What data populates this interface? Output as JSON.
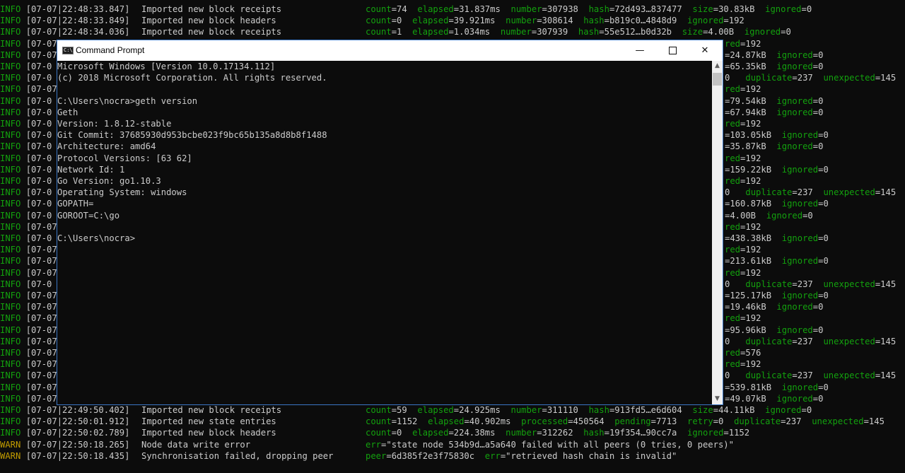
{
  "background_log": [
    {
      "level": "INFO",
      "time": "[07-07|22:48:33.847]",
      "msg": "Imported new block receipts",
      "fields": [
        [
          "count",
          "74"
        ],
        [
          "elapsed",
          "31.837ms"
        ],
        [
          "number",
          "307938"
        ],
        [
          "hash",
          "72d493…837477"
        ],
        [
          "size",
          "30.83kB"
        ],
        [
          "ignored",
          "0"
        ]
      ],
      "right": []
    },
    {
      "level": "INFO",
      "time": "[07-07|22:48:33.849]",
      "msg": "Imported new block headers",
      "fields": [
        [
          "count",
          "0"
        ],
        [
          "elapsed",
          "39.921ms"
        ],
        [
          "number",
          "308614"
        ],
        [
          "hash",
          "b819c0…4848d9"
        ],
        [
          "ignored",
          "192"
        ]
      ],
      "right": []
    },
    {
      "level": "INFO",
      "time": "[07-07|22:48:34.036]",
      "msg": "Imported new block receipts",
      "fields": [
        [
          "count",
          "1"
        ],
        [
          "elapsed",
          "1.034ms"
        ],
        [
          "number",
          "307939"
        ],
        [
          "hash",
          "55e512…b0d32b"
        ],
        [
          "size",
          "4.00B"
        ],
        [
          "ignored",
          "0"
        ]
      ],
      "right": []
    },
    {
      "level": "INFO",
      "time": "[07-07",
      "msg": "",
      "fields": [],
      "right": [
        [
          "red",
          "192"
        ]
      ]
    },
    {
      "level": "INFO",
      "time": "[07-07",
      "msg": "",
      "fields": [],
      "right": [
        [
          "",
          "24.87kB"
        ],
        [
          "ignored",
          "0"
        ]
      ]
    },
    {
      "level": "INFO",
      "time": "[07-0",
      "msg": "",
      "fields": [],
      "right": [
        [
          "",
          "65.35kB"
        ],
        [
          "ignored",
          "0"
        ]
      ]
    },
    {
      "level": "INFO",
      "time": "[07-0",
      "msg": "",
      "fields": [],
      "right": [
        [
          "0 ",
          ""
        ],
        [
          "duplicate",
          "237"
        ],
        [
          "unexpected",
          "145"
        ]
      ]
    },
    {
      "level": "INFO",
      "time": "[07-07",
      "msg": "",
      "fields": [],
      "right": [
        [
          "red",
          "192"
        ]
      ]
    },
    {
      "level": "INFO",
      "time": "[07-0",
      "msg": "",
      "fields": [],
      "right": [
        [
          "",
          "79.54kB"
        ],
        [
          "ignored",
          "0"
        ]
      ]
    },
    {
      "level": "INFO",
      "time": "[07-0",
      "msg": "",
      "fields": [],
      "right": [
        [
          "",
          "67.94kB"
        ],
        [
          "ignored",
          "0"
        ]
      ]
    },
    {
      "level": "INFO",
      "time": "[07-0",
      "msg": "",
      "fields": [],
      "right": [
        [
          "red",
          "192"
        ]
      ]
    },
    {
      "level": "INFO",
      "time": "[07-0",
      "msg": "",
      "fields": [],
      "right": [
        [
          "",
          "103.05kB"
        ],
        [
          "ignored",
          "0"
        ]
      ]
    },
    {
      "level": "INFO",
      "time": "[07-0",
      "msg": "",
      "fields": [],
      "right": [
        [
          "",
          "35.87kB"
        ],
        [
          "ignored",
          "0"
        ]
      ]
    },
    {
      "level": "INFO",
      "time": "[07-0",
      "msg": "",
      "fields": [],
      "right": [
        [
          "red",
          "192"
        ]
      ]
    },
    {
      "level": "INFO",
      "time": "[07-0",
      "msg": "",
      "fields": [],
      "right": [
        [
          "",
          "159.22kB"
        ],
        [
          "ignored",
          "0"
        ]
      ]
    },
    {
      "level": "INFO",
      "time": "[07-0",
      "msg": "",
      "fields": [],
      "right": [
        [
          "red",
          "192"
        ]
      ]
    },
    {
      "level": "INFO",
      "time": "[07-0",
      "msg": "",
      "fields": [],
      "right": [
        [
          "0 ",
          ""
        ],
        [
          "duplicate",
          "237"
        ],
        [
          "unexpected",
          "145"
        ]
      ]
    },
    {
      "level": "INFO",
      "time": "[07-0",
      "msg": "",
      "fields": [],
      "right": [
        [
          "",
          "160.87kB"
        ],
        [
          "ignored",
          "0"
        ]
      ]
    },
    {
      "level": "INFO",
      "time": "[07-0",
      "msg": "",
      "fields": [],
      "right": [
        [
          "",
          "4.00B"
        ],
        [
          "ignored",
          "0"
        ]
      ]
    },
    {
      "level": "INFO",
      "time": "[07-07",
      "msg": "",
      "fields": [],
      "right": [
        [
          "red",
          "192"
        ]
      ]
    },
    {
      "level": "INFO",
      "time": "[07-0",
      "msg": "",
      "fields": [],
      "right": [
        [
          "",
          "438.38kB"
        ],
        [
          "ignored",
          "0"
        ]
      ]
    },
    {
      "level": "INFO",
      "time": "[07-07",
      "msg": "",
      "fields": [],
      "right": [
        [
          "red",
          "192"
        ]
      ]
    },
    {
      "level": "INFO",
      "time": "[07-07",
      "msg": "",
      "fields": [],
      "right": [
        [
          "",
          "213.61kB"
        ],
        [
          "ignored",
          "0"
        ]
      ]
    },
    {
      "level": "INFO",
      "time": "[07-07",
      "msg": "",
      "fields": [],
      "right": [
        [
          "red",
          "192"
        ]
      ]
    },
    {
      "level": "INFO",
      "time": "[07-0",
      "msg": "",
      "fields": [],
      "right": [
        [
          "0 ",
          ""
        ],
        [
          "duplicate",
          "237"
        ],
        [
          "unexpected",
          "145"
        ]
      ]
    },
    {
      "level": "INFO",
      "time": "[07-07",
      "msg": "",
      "fields": [],
      "right": [
        [
          "",
          "125.17kB"
        ],
        [
          "ignored",
          "0"
        ]
      ]
    },
    {
      "level": "INFO",
      "time": "[07-07",
      "msg": "",
      "fields": [],
      "right": [
        [
          "",
          "19.46kB"
        ],
        [
          "ignored",
          "0"
        ]
      ]
    },
    {
      "level": "INFO",
      "time": "[07-07",
      "msg": "",
      "fields": [],
      "right": [
        [
          "red",
          "192"
        ]
      ]
    },
    {
      "level": "INFO",
      "time": "[07-07",
      "msg": "",
      "fields": [],
      "right": [
        [
          "",
          "95.96kB"
        ],
        [
          "ignored",
          "0"
        ]
      ]
    },
    {
      "level": "INFO",
      "time": "[07-07",
      "msg": "",
      "fields": [],
      "right": [
        [
          "0 ",
          ""
        ],
        [
          "duplicate",
          "237"
        ],
        [
          "unexpected",
          "145"
        ]
      ]
    },
    {
      "level": "INFO",
      "time": "[07-07",
      "msg": "",
      "fields": [],
      "right": [
        [
          "red",
          "576"
        ]
      ]
    },
    {
      "level": "INFO",
      "time": "[07-07",
      "msg": "",
      "fields": [],
      "right": [
        [
          "red",
          "192"
        ]
      ]
    },
    {
      "level": "INFO",
      "time": "[07-07",
      "msg": "",
      "fields": [],
      "right": [
        [
          "0 ",
          ""
        ],
        [
          "duplicate",
          "237"
        ],
        [
          "unexpected",
          "145"
        ]
      ]
    },
    {
      "level": "INFO",
      "time": "[07-07",
      "msg": "",
      "fields": [],
      "right": [
        [
          "",
          "539.81kB"
        ],
        [
          "ignored",
          "0"
        ]
      ]
    },
    {
      "level": "INFO",
      "time": "[07-07",
      "msg": "",
      "fields": [],
      "right": [
        [
          "",
          "49.07kB"
        ],
        [
          "ignored",
          "0"
        ]
      ]
    },
    {
      "level": "INFO",
      "time": "[07-07|22:49:50.402]",
      "msg": "Imported new block receipts",
      "fields": [
        [
          "count",
          "59"
        ],
        [
          "elapsed",
          "24.925ms"
        ],
        [
          "number",
          "311110"
        ],
        [
          "hash",
          "913fd5…e6d604"
        ],
        [
          "size",
          "44.11kB"
        ],
        [
          "ignored",
          "0"
        ]
      ],
      "right": []
    },
    {
      "level": "INFO",
      "time": "[07-07|22:50:01.912]",
      "msg": "Imported new state entries",
      "fields": [
        [
          "count",
          "1152"
        ],
        [
          "elapsed",
          "40.902ms"
        ],
        [
          "processed",
          "450564"
        ],
        [
          "pending",
          "7713"
        ],
        [
          "retry",
          "0"
        ],
        [
          "duplicate",
          "237"
        ],
        [
          "unexpected",
          "145"
        ]
      ],
      "right": []
    },
    {
      "level": "INFO",
      "time": "[07-07|22:50:02.789]",
      "msg": "Imported new block headers",
      "fields": [
        [
          "count",
          "0"
        ],
        [
          "elapsed",
          "224.38ms"
        ],
        [
          "number",
          "312262"
        ],
        [
          "hash",
          "19f354…90cc7a"
        ],
        [
          "ignored",
          "1152"
        ]
      ],
      "right": []
    },
    {
      "level": "WARN",
      "time": "[07-07|22:50:18.265]",
      "msg": "Node data write error",
      "fields": [
        [
          "err",
          "\"state node 534b9d…a5a640 failed with all peers (0 tries, 0 peers)\""
        ]
      ],
      "right": []
    },
    {
      "level": "WARN",
      "time": "[07-07|22:50:18.435]",
      "msg": "Synchronisation failed, dropping peer",
      "fields": [
        [
          "peer",
          "6d385f2e3f75830c"
        ],
        [
          "err",
          "\"retrieved hash chain is invalid\""
        ]
      ],
      "right": []
    }
  ],
  "window": {
    "title": "Command Prompt",
    "icon_label": "C:\\",
    "minimize_label": "—",
    "close_label": "✕"
  },
  "console_lines": [
    "Microsoft Windows [Version 10.0.17134.112]",
    "(c) 2018 Microsoft Corporation. All rights reserved.",
    "",
    "C:\\Users\\nocra>geth version",
    "Geth",
    "Version: 1.8.12-stable",
    "Git Commit: 37685930d953bcbe023f9bc65b135a8d8b8f1488",
    "Architecture: amd64",
    "Protocol Versions: [63 62]",
    "Network Id: 1",
    "Go Version: go1.10.3",
    "Operating System: windows",
    "GOPATH=",
    "GOROOT=C:\\go",
    "",
    "C:\\Users\\nocra>"
  ],
  "scrollbar": {
    "up_label": "▲",
    "down_label": "▼"
  },
  "colors": {
    "info_green": "#13a10e",
    "warn_yellow": "#c19c00",
    "console_text": "#cccccc",
    "window_border": "#3a76c4"
  }
}
